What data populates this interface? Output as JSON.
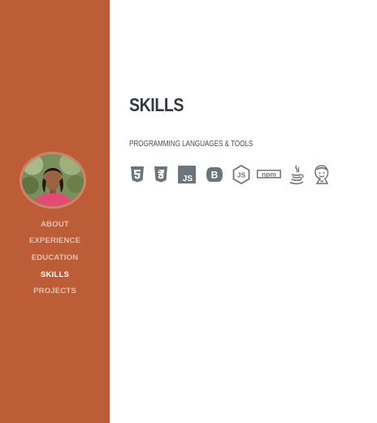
{
  "sidebar": {
    "avatar": {
      "alt_icon": "profile-photo"
    },
    "nav": [
      {
        "label": "About",
        "active": false
      },
      {
        "label": "Experience",
        "active": false
      },
      {
        "label": "Education",
        "active": false
      },
      {
        "label": "Skills",
        "active": true
      },
      {
        "label": "Projects",
        "active": false
      }
    ],
    "colors": {
      "background": "#bd5d38",
      "link": "rgba(255,255,255,0.6)",
      "active_link": "#ffffff"
    }
  },
  "skills": {
    "title": "Skills",
    "subheading": "Programming Languages & Tools",
    "icons": [
      {
        "name": "html5-icon"
      },
      {
        "name": "css3-icon"
      },
      {
        "name": "js-icon",
        "text": "JS"
      },
      {
        "name": "bootstrap-icon",
        "text": "B"
      },
      {
        "name": "nodejs-icon",
        "text": "JS"
      },
      {
        "name": "npm-icon",
        "text": "npm"
      },
      {
        "name": "java-icon"
      },
      {
        "name": "jenkins-icon"
      }
    ],
    "icon_color": "#6c757d"
  }
}
